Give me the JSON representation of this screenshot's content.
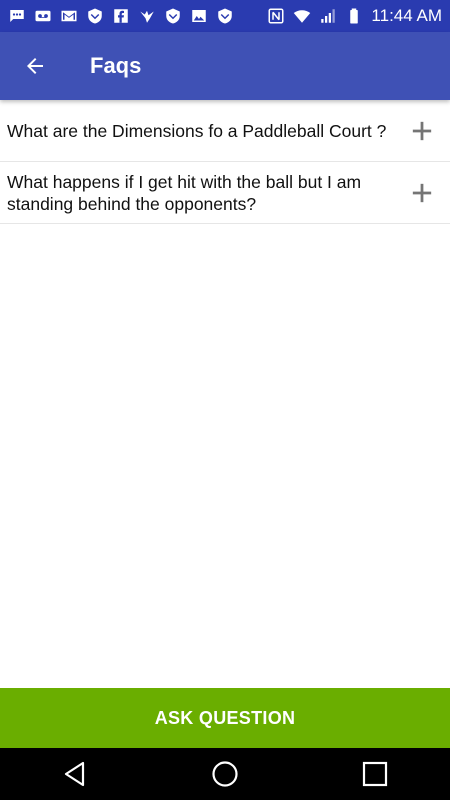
{
  "status_bar": {
    "time": "11:44 AM",
    "left_icons": [
      "chat-icon",
      "voicemail-icon",
      "gmail-icon",
      "shield-icon",
      "facebook-icon",
      "bird-icon",
      "shield-icon",
      "image-icon",
      "shield-icon"
    ],
    "right_icons": [
      "nfc-icon",
      "wifi-icon",
      "signal-icon",
      "battery-icon"
    ]
  },
  "app_bar": {
    "title": "Faqs",
    "back_icon": "arrow-back-icon",
    "color": "#3f51b5"
  },
  "faqs": [
    {
      "question": "What are the Dimensions fo a Paddleball Court ?",
      "icon": "plus-icon"
    },
    {
      "question": "What happens if I get hit with the ball but I am standing behind the opponents?",
      "icon": "plus-icon"
    }
  ],
  "ask_button": {
    "label": "ASK QUESTION",
    "color": "#6aae00"
  },
  "nav_bar": {
    "buttons": [
      "back-triangle-icon",
      "home-circle-icon",
      "recents-square-icon"
    ]
  }
}
